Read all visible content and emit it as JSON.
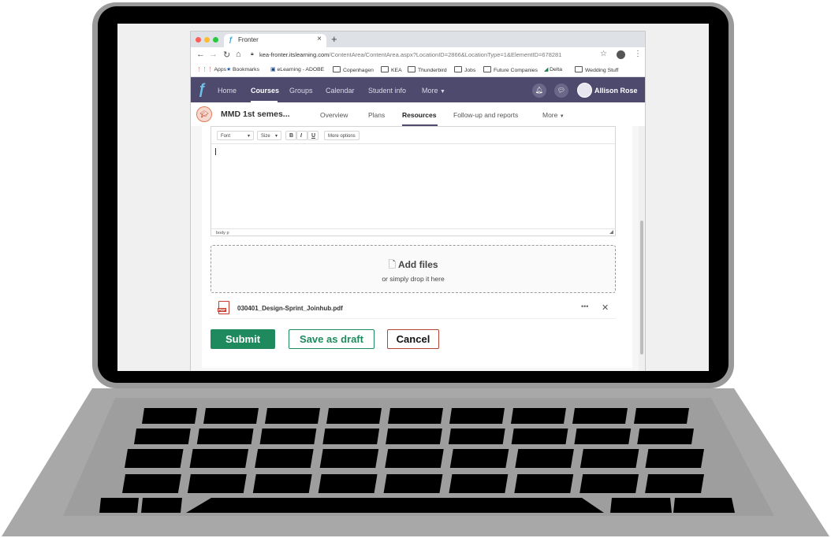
{
  "browser": {
    "tab_title": "Fronter",
    "tab_close": "×",
    "new_tab": "+",
    "url_host": "kea-fronter.itslearning.com",
    "url_path": "/ContentArea/ContentArea.aspx?LocationID=2866&LocationType=1&ElementID=678281",
    "window_dots": [
      "#ff5f57",
      "#febc2e",
      "#28c840"
    ]
  },
  "bookmarks": [
    {
      "label": "Apps",
      "icon": "apps-grid-icon"
    },
    {
      "label": "Bookmarks",
      "icon": "star-icon"
    },
    {
      "label": "eLearning - ADOBE",
      "icon": "bookmark-page-icon"
    },
    {
      "label": "Copenhagen",
      "icon": "folder-icon"
    },
    {
      "label": "KEA",
      "icon": "folder-icon"
    },
    {
      "label": "Thunderbird",
      "icon": "folder-icon"
    },
    {
      "label": "Jobs",
      "icon": "folder-icon"
    },
    {
      "label": "Future Companies",
      "icon": "folder-icon"
    },
    {
      "label": "Delta",
      "icon": "delta-logo-icon"
    },
    {
      "label": "Wedding Stuff",
      "icon": "folder-icon"
    }
  ],
  "app_nav": {
    "items": [
      "Home",
      "Courses",
      "Groups",
      "Calendar",
      "Student info",
      "More"
    ],
    "active": "Courses",
    "user_name": "Allison Rose",
    "color": "#4e4a6e"
  },
  "course": {
    "title": "MMD 1st semes...",
    "tabs": [
      "Overview",
      "Plans",
      "Resources",
      "Follow-up and reports",
      "More"
    ],
    "active_tab": "Resources"
  },
  "editor": {
    "toolbar": {
      "font": "Font",
      "size": "Size",
      "bold": "B",
      "italic": "I",
      "underline": "U",
      "more_options": "More options"
    },
    "status_path": "body  p"
  },
  "dropzone": {
    "title": "Add files",
    "subtitle": "or simply drop it here"
  },
  "attachment": {
    "filename": "030401_Design-Sprint_Joinhub.pdf",
    "type_tag": "PDF"
  },
  "actions": {
    "submit": "Submit",
    "save_draft": "Save as draft",
    "cancel": "Cancel",
    "accent": "#1e8a5e"
  }
}
